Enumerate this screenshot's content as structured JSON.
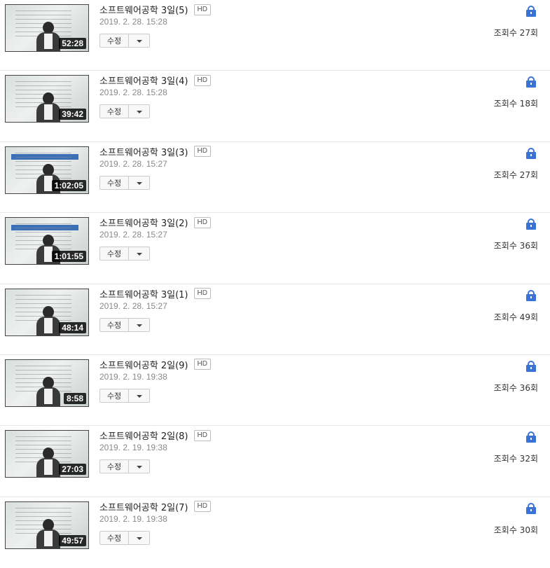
{
  "videos": [
    {
      "title": "소프트웨어공학 3일(5)",
      "badge": "HD",
      "date": "2019. 2. 28. 15:28",
      "duration": "52:28",
      "edit_label": "수정",
      "views": "조회수 27회",
      "style": "lecture"
    },
    {
      "title": "소프트웨어공학 3일(4)",
      "badge": "HD",
      "date": "2019. 2. 28. 15:28",
      "duration": "39:42",
      "edit_label": "수정",
      "views": "조회수 18회",
      "style": "lecture"
    },
    {
      "title": "소프트웨어공학 3일(3)",
      "badge": "HD",
      "date": "2019. 2. 28. 15:27",
      "duration": "1:02:05",
      "edit_label": "수정",
      "views": "조회수 27회",
      "style": "slide"
    },
    {
      "title": "소프트웨어공학 3일(2)",
      "badge": "HD",
      "date": "2019. 2. 28. 15:27",
      "duration": "1:01:55",
      "edit_label": "수정",
      "views": "조회수 36회",
      "style": "slide"
    },
    {
      "title": "소프트웨어공학 3일(1)",
      "badge": "HD",
      "date": "2019. 2. 28. 15:27",
      "duration": "48:14",
      "edit_label": "수정",
      "views": "조회수 49회",
      "style": "lecture"
    },
    {
      "title": "소프트웨어공학 2일(9)",
      "badge": "HD",
      "date": "2019. 2. 19. 19:38",
      "duration": "8:58",
      "edit_label": "수정",
      "views": "조회수 36회",
      "style": "lecture"
    },
    {
      "title": "소프트웨어공학 2일(8)",
      "badge": "HD",
      "date": "2019. 2. 19. 19:38",
      "duration": "27:03",
      "edit_label": "수정",
      "views": "조회수 32회",
      "style": "lecture"
    },
    {
      "title": "소프트웨어공학 2일(7)",
      "badge": "HD",
      "date": "2019. 2. 19. 19:38",
      "duration": "49:57",
      "edit_label": "수정",
      "views": "조회수 30회",
      "style": "lecture"
    }
  ],
  "icons": {
    "lock": "lock-icon",
    "dropdown": "chevron-down-icon"
  },
  "colors": {
    "lock": "#3a72d6",
    "date": "#888888",
    "divider": "#e8e8e8"
  }
}
